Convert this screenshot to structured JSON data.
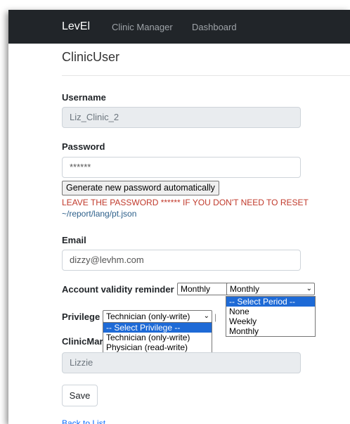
{
  "navbar": {
    "brand": "LevEl",
    "links": [
      "Clinic Manager",
      "Dashboard"
    ]
  },
  "page": {
    "heading": "ClinicUser"
  },
  "form": {
    "username": {
      "label": "Username",
      "value": "Liz_Clinic_2"
    },
    "password": {
      "label": "Password",
      "value": "******",
      "generate_label": "Generate new password automatically",
      "warning": "LEAVE THE PASSWORD ****** IF YOU DON'T NEED TO RESET",
      "warning_path": "~/report/lang/pt.json"
    },
    "email": {
      "label": "Email",
      "value": "dizzy@levhm.com"
    },
    "account_validity": {
      "label": "Account validity reminder",
      "back_value": "Monthly",
      "value": "Monthly",
      "options": [
        "-- Select Period --",
        "None",
        "Weekly",
        "Monthly"
      ],
      "highlighted": "-- Select Period --"
    },
    "privilege": {
      "label": "Privilege",
      "value": "Technician (only-write)",
      "options": [
        "-- Select Privilege --",
        "Technician (only-write)",
        "Physician (read-write)"
      ],
      "highlighted": "-- Select Privilege --"
    },
    "clinic_manager": {
      "label": "ClinicMar",
      "value": "Lizzie"
    },
    "save_label": "Save",
    "back_label": "Back to List"
  },
  "colors": {
    "navbar": "#212529",
    "highlight": "#1e6ad6",
    "warning": "#c0392b",
    "link": "#0d6efd"
  }
}
